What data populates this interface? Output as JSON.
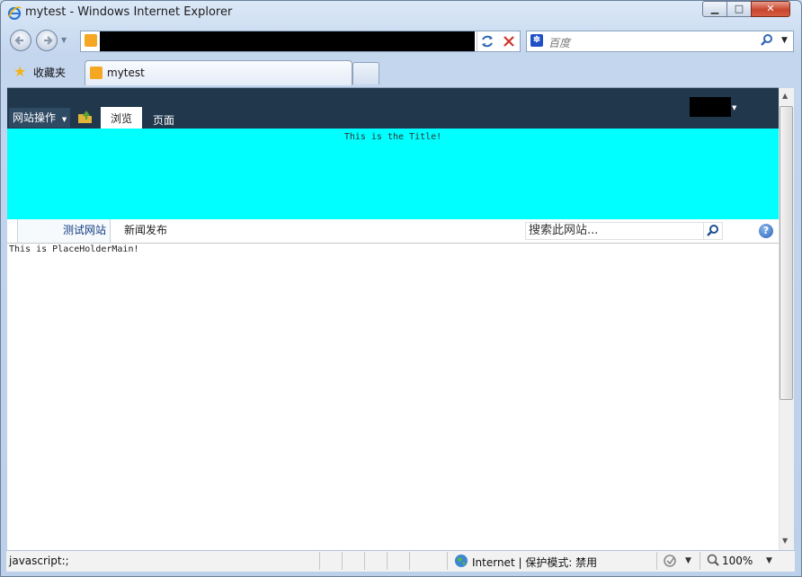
{
  "window": {
    "title": "mytest - Windows Internet Explorer"
  },
  "toolbar": {
    "search_placeholder": "百度"
  },
  "tabs": {
    "favorites_label": "收藏夹",
    "active_tab_label": "mytest"
  },
  "ribbon": {
    "site_actions_label": "网站操作",
    "tab_browse": "浏览",
    "tab_page": "页面"
  },
  "banner": {
    "title": "This is the Title!"
  },
  "topnav": {
    "home": "测试网站",
    "news": "新闻发布",
    "search_placeholder": "搜索此网站..."
  },
  "main": {
    "placeholder_text": "This is PlaceHolderMain!"
  },
  "statusbar": {
    "url": "javascript:;",
    "zone": "Internet | 保护模式: 禁用",
    "zoom": "100%"
  },
  "colors": {
    "ribbon_bg": "#21374c",
    "banner_bg": "#00ffff",
    "accent_link": "#0f3b82"
  }
}
